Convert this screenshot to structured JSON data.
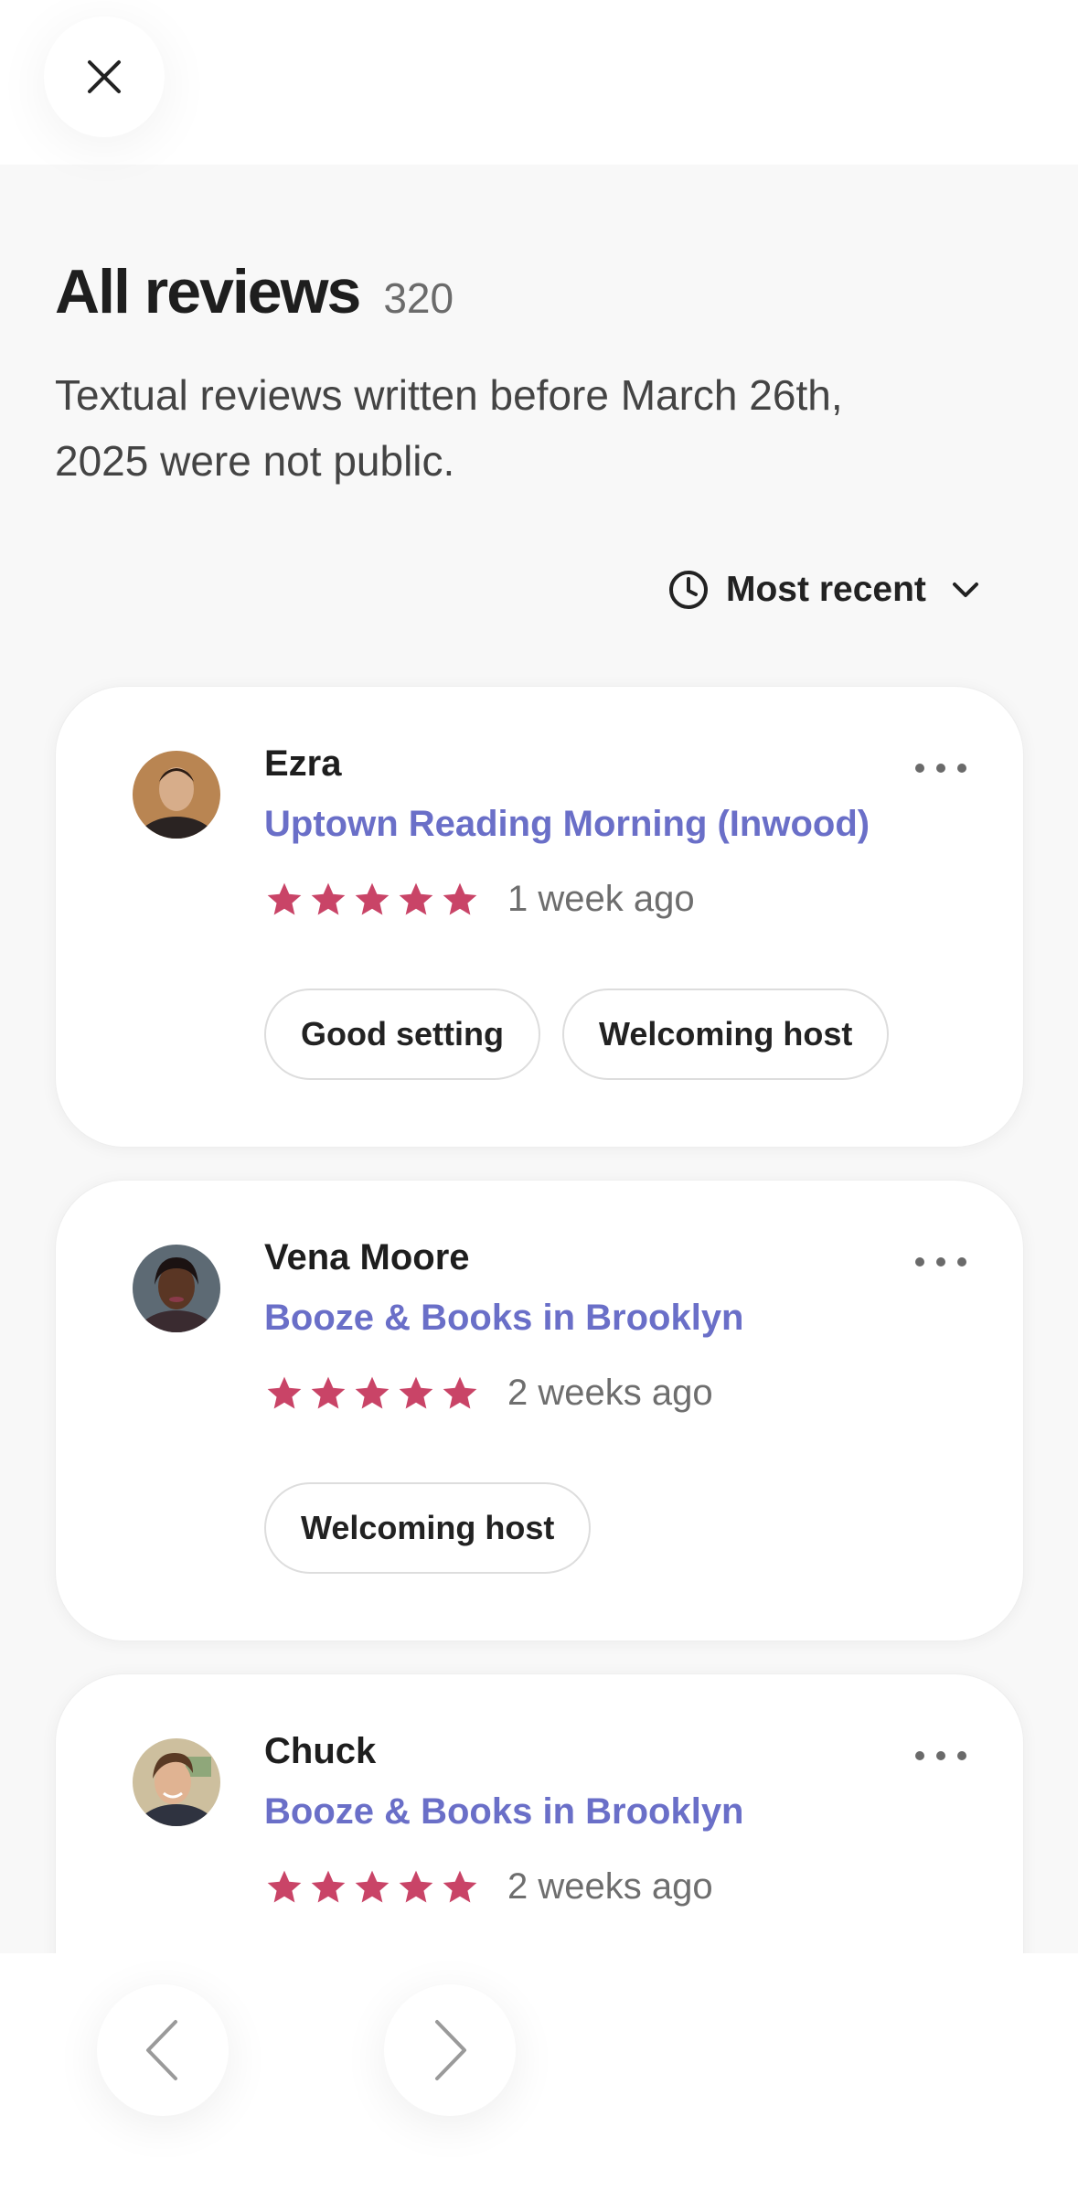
{
  "header": {
    "close_icon": "close-icon",
    "title": "All reviews",
    "count": "320",
    "subtitle": "Textual reviews written before March 26th, 2025 were not public."
  },
  "sort": {
    "icon": "clock-icon",
    "label": "Most recent",
    "chevron": "chevron-down-icon"
  },
  "colors": {
    "star": "#c94467",
    "event_link": "#6a6fc8"
  },
  "reviews": [
    {
      "name": "Ezra",
      "event": "Uptown Reading Morning (Inwood)",
      "rating": 5,
      "time": "1 week ago",
      "tags": [
        "Good setting",
        "Welcoming host"
      ]
    },
    {
      "name": "Vena Moore",
      "event": "Booze & Books in Brooklyn",
      "rating": 5,
      "time": "2 weeks ago",
      "tags": [
        "Welcoming host"
      ]
    },
    {
      "name": "Chuck",
      "event": "Booze & Books in Brooklyn",
      "rating": 5,
      "time": "2 weeks ago",
      "tags": []
    }
  ],
  "pagination": {
    "prev_icon": "chevron-left-icon",
    "next_icon": "chevron-right-icon"
  }
}
